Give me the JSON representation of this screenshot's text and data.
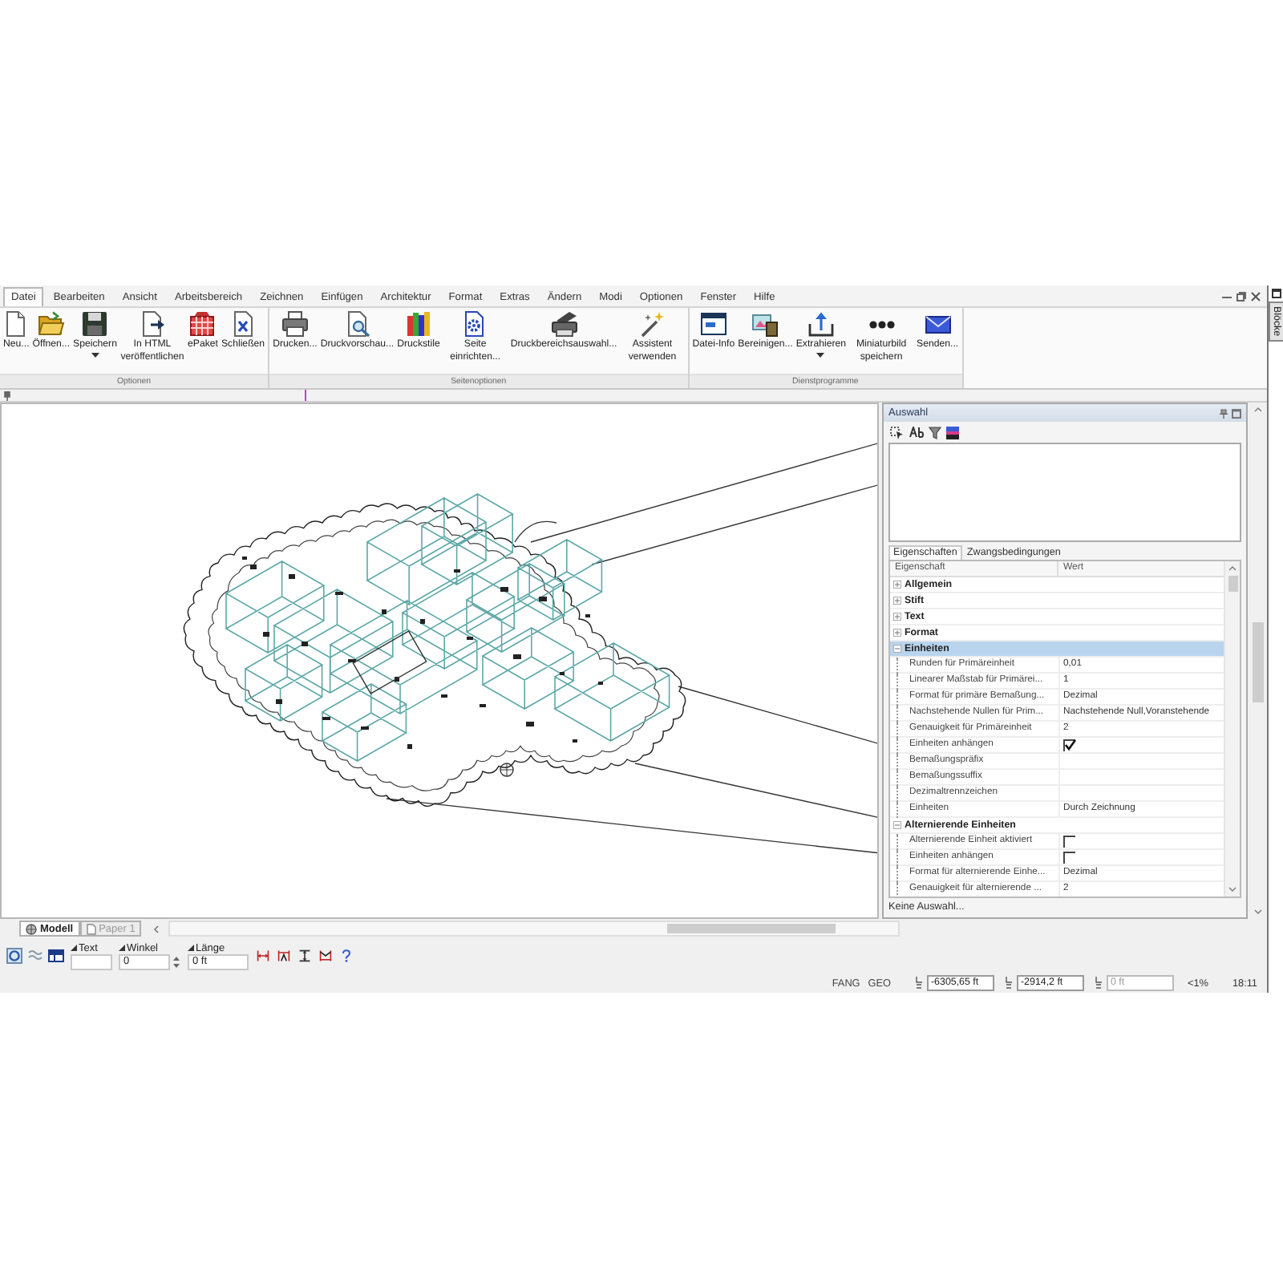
{
  "window": {
    "side_tab": "Blöcke"
  },
  "menu": [
    {
      "label": "Datei",
      "selected": true
    },
    {
      "label": "Bearbeiten",
      "selected": false
    },
    {
      "label": "Ansicht",
      "selected": false
    },
    {
      "label": "Arbeitsbereich",
      "selected": false
    },
    {
      "label": "Zeichnen",
      "selected": false
    },
    {
      "label": "Einfügen",
      "selected": false
    },
    {
      "label": "Architektur",
      "selected": false
    },
    {
      "label": "Format",
      "selected": false
    },
    {
      "label": "Extras",
      "selected": false
    },
    {
      "label": "Ändern",
      "selected": false
    },
    {
      "label": "Modi",
      "selected": false
    },
    {
      "label": "Optionen",
      "selected": false
    },
    {
      "label": "Fenster",
      "selected": false
    },
    {
      "label": "Hilfe",
      "selected": false
    }
  ],
  "ribbon": [
    {
      "label": "Optionen",
      "buttons": [
        {
          "label": "Neu...",
          "dropdown": false
        },
        {
          "label": "Öffnen...",
          "dropdown": false
        },
        {
          "label": "Speichern",
          "dropdown": true
        },
        {
          "label": "In HTML veröffentlichen",
          "dropdown": false
        },
        {
          "label": "ePaket",
          "dropdown": false
        },
        {
          "label": "Schließen",
          "dropdown": false
        }
      ]
    },
    {
      "label": "Seitenoptionen",
      "buttons": [
        {
          "label": "Drucken...",
          "dropdown": false
        },
        {
          "label": "Druckvorschau...",
          "dropdown": false
        },
        {
          "label": "Druckstile",
          "dropdown": false
        },
        {
          "label": "Seite einrichten...",
          "dropdown": false
        },
        {
          "label": "Druckbereichsauswahl...",
          "dropdown": false
        },
        {
          "label": "Assistent verwenden",
          "dropdown": false
        }
      ]
    },
    {
      "label": "Dienstprogramme",
      "buttons": [
        {
          "label": "Datei-Info",
          "dropdown": false
        },
        {
          "label": "Bereinigen...",
          "dropdown": false
        },
        {
          "label": "Extrahieren",
          "dropdown": true
        },
        {
          "label": "Miniaturbild speichern",
          "dropdown": false
        },
        {
          "label": "Senden...",
          "dropdown": false
        }
      ]
    }
  ],
  "layout_tabs": [
    {
      "label": "Modell",
      "selected": true
    },
    {
      "label": "Paper 1",
      "selected": false
    }
  ],
  "properties_panel": {
    "title": "Auswahl",
    "tabs": [
      {
        "label": "Eigenschaften",
        "selected": true
      },
      {
        "label": "Zwangsbedingungen",
        "selected": false
      }
    ],
    "columns": [
      "Eigenschaft",
      "Wert"
    ],
    "categories": [
      {
        "label": "Allgemein",
        "expanded": false,
        "selected": false
      },
      {
        "label": "Stift",
        "expanded": false,
        "selected": false
      },
      {
        "label": "Text",
        "expanded": false,
        "selected": false
      },
      {
        "label": "Format",
        "expanded": false,
        "selected": false
      },
      {
        "label": "Einheiten",
        "expanded": true,
        "selected": true,
        "children": [
          {
            "kind": "text",
            "name": "Runden für Primäreinheit",
            "value": "0,01"
          },
          {
            "kind": "text",
            "name": "Linearer Maßstab für Primärei...",
            "value": "1"
          },
          {
            "kind": "text",
            "name": "Format für primäre Bemaßung...",
            "value": "Dezimal"
          },
          {
            "kind": "text",
            "name": "Nachstehende Nullen für Prim...",
            "value": "Nachstehende Null,Voranstehende"
          },
          {
            "kind": "text",
            "name": "Genauigkeit für Primäreinheit",
            "value": "2"
          },
          {
            "kind": "checkbox",
            "name": "Einheiten anhängen",
            "checked": true
          },
          {
            "kind": "text",
            "name": "Bemaßungspräfix"
          },
          {
            "kind": "text",
            "name": "Bemaßungssuffix"
          },
          {
            "kind": "text",
            "name": "Dezimaltrennzeichen"
          },
          {
            "kind": "text",
            "name": "Einheiten",
            "value": "Durch Zeichnung"
          }
        ]
      },
      {
        "label": "Alternierende Einheiten",
        "expanded": true,
        "selected": false,
        "children": [
          {
            "kind": "checkbox",
            "name": "Alternierende Einheit aktiviert",
            "checked": false
          },
          {
            "kind": "checkbox",
            "name": "Einheiten anhängen",
            "checked": false
          },
          {
            "kind": "text",
            "name": "Format für alternierende Einhe...",
            "value": "Dezimal"
          },
          {
            "kind": "text",
            "name": "Genauigkeit für alternierende ...",
            "value": "2"
          }
        ]
      }
    ],
    "footer": "Keine Auswahl..."
  },
  "command_bar": {
    "fields": [
      {
        "label": "Text",
        "spinner": false
      },
      {
        "label": "Winkel",
        "value": "0",
        "spinner": true
      },
      {
        "label": "Länge",
        "value": "0 ft",
        "spinner": false
      }
    ]
  },
  "status_bar": {
    "toggles": [
      "FANG",
      "GEO"
    ],
    "coordinates": [
      {
        "value": "-6305,65 ft",
        "disabled": false
      },
      {
        "value": "-2914,2 ft",
        "disabled": false
      },
      {
        "value": "0 ft",
        "disabled": true
      }
    ],
    "zoom": "<1%",
    "time": "18:11"
  }
}
